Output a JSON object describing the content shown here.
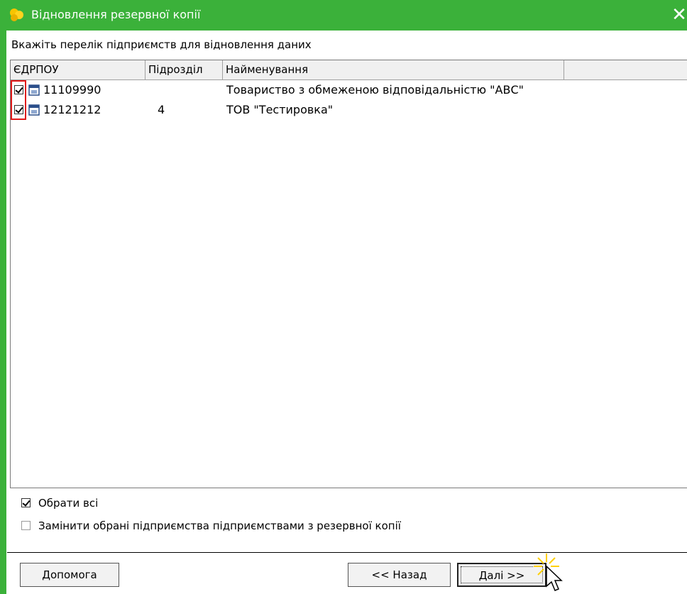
{
  "window": {
    "title": "Відновлення резервної копії",
    "close_glyph": "✕",
    "accent_color": "#3bb13a"
  },
  "instruction": "Вкажіть перелік підприємств для відновлення даних",
  "grid": {
    "columns": [
      "ЄДРПОУ",
      "Підрозділ",
      "Найменування"
    ],
    "rows": [
      {
        "checked": true,
        "code": "11109990",
        "division": "",
        "name": "Товариство з обмеженою відповідальністю \"АВС\""
      },
      {
        "checked": true,
        "code": "12121212",
        "division": "4",
        "name": "ТОВ \"Тестировка\""
      }
    ]
  },
  "options": {
    "select_all": {
      "label": "Обрати всі",
      "checked": true
    },
    "replace": {
      "label": "Замінити обрані підприємства підприємствами з резервної копії",
      "checked": false
    }
  },
  "buttons": {
    "help": "Допомога",
    "back": "<< Назад",
    "next": "Далі >>"
  },
  "icons": {
    "app": "yellow-flower-icon",
    "row": "enterprise-card-icon",
    "cursor": "pointer-cursor-icon"
  }
}
